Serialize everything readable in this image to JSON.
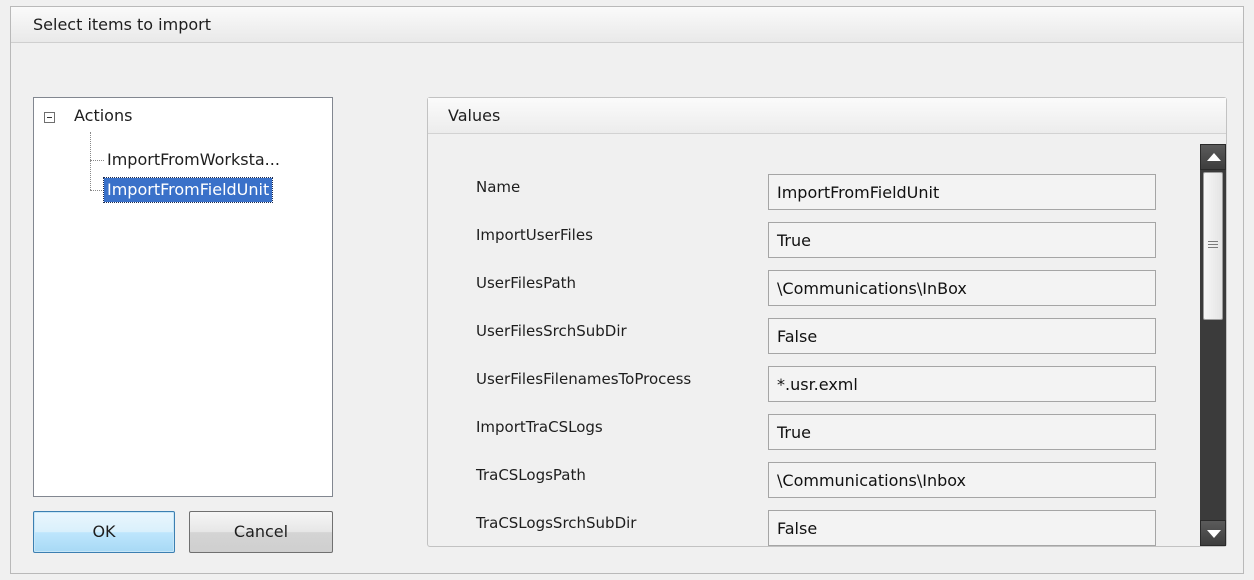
{
  "window": {
    "title": "Select items to import"
  },
  "tree": {
    "root_label": "Actions",
    "children": [
      {
        "label": "ImportFromWorksta..."
      },
      {
        "label": "ImportFromFieldUnit"
      }
    ]
  },
  "buttons": {
    "ok_label": "OK",
    "cancel_label": "Cancel"
  },
  "values_panel": {
    "title": "Values",
    "rows": [
      {
        "label": "Name",
        "value": "ImportFromFieldUnit"
      },
      {
        "label": "ImportUserFiles",
        "value": "True"
      },
      {
        "label": "UserFilesPath",
        "value": "\\Communications\\InBox"
      },
      {
        "label": "UserFilesSrchSubDir",
        "value": "False"
      },
      {
        "label": "UserFilesFilenamesToProcess",
        "value": "*.usr.exml"
      },
      {
        "label": "ImportTraCSLogs",
        "value": "True"
      },
      {
        "label": "TraCSLogsPath",
        "value": "\\Communications\\Inbox"
      },
      {
        "label": "TraCSLogsSrchSubDir",
        "value": "False"
      }
    ]
  },
  "icons": {
    "tree_toggle": "collapse-minus-icon",
    "scroll_up": "arrow-up-icon",
    "scroll_down": "arrow-down-icon",
    "scroll_grip": "grip-icon"
  },
  "colors": {
    "selection": "#3a71c9",
    "scrollbar": "#3b3b3b"
  }
}
